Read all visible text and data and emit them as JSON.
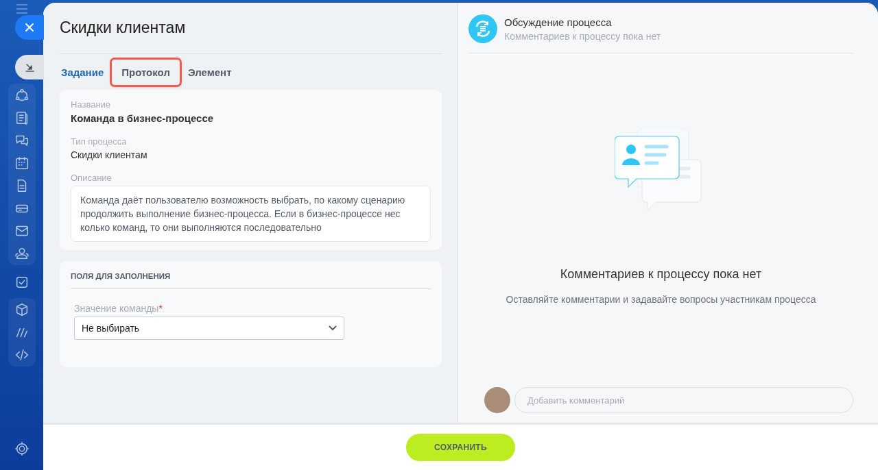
{
  "title": "Скидки клиентам",
  "tabs": [
    {
      "label": "Задание",
      "selected": true,
      "highlighted": false
    },
    {
      "label": "Протокол",
      "selected": false,
      "highlighted": true
    },
    {
      "label": "Элемент",
      "selected": false,
      "highlighted": false
    }
  ],
  "info": [
    {
      "label": "Название",
      "value": "Команда в бизнес-процессе",
      "kind": "bold"
    },
    {
      "label": "Тип процесса",
      "value": "Скидки клиентам",
      "kind": "plain"
    },
    {
      "label": "Описание",
      "value": "Команда даёт пользователю возможность выбрать, по какому сценарию продолжить выполнение бизнес-процесса. Если в бизнес-процессе нес колько команд, то они выполняются последовательно",
      "kind": "boxed"
    }
  ],
  "fields_section": {
    "heading": "ПОЛЯ ДЛЯ ЗАПОЛНЕНИЯ",
    "field": {
      "label": "Значение команды",
      "required_mark": "*",
      "value": "Не выбирать"
    }
  },
  "discussion": {
    "title": "Обсуждение процесса",
    "subtitle": "Комментариев к процессу пока нет",
    "empty_title": "Комментариев к процессу пока нет",
    "empty_text": "Оставляйте комментарии и задавайте вопросы участникам процесса",
    "comment": {
      "placeholder": "Добавить комментарий"
    }
  },
  "save_button": "СОХРАНИТЬ"
}
